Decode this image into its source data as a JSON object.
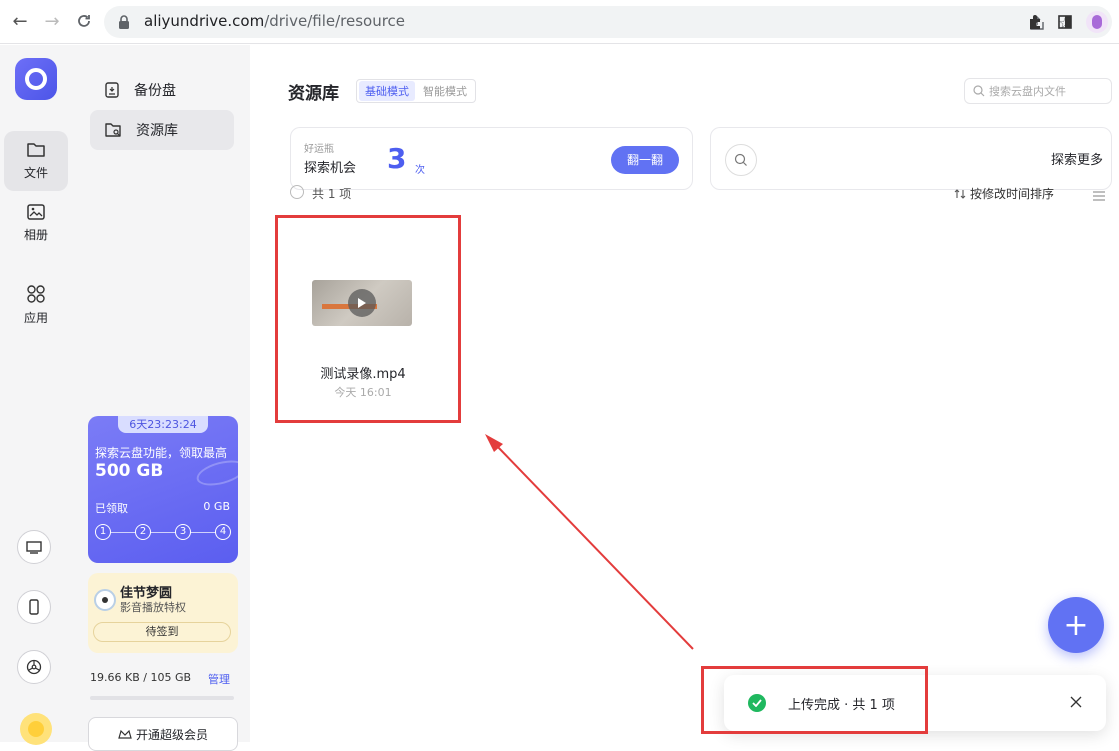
{
  "browser": {
    "url_domain": "aliyundrive.com",
    "url_path": "/drive/file/resource"
  },
  "rail": {
    "items": [
      {
        "label": "文件",
        "icon": "folder-icon"
      },
      {
        "label": "相册",
        "icon": "photo-icon"
      },
      {
        "label": "应用",
        "icon": "apps-icon"
      }
    ]
  },
  "side": {
    "items": [
      {
        "label": "备份盘",
        "icon": "backup-disk-icon"
      },
      {
        "label": "资源库",
        "icon": "resource-folder-icon"
      }
    ],
    "promo": {
      "timer": "6天23:23:24",
      "line1": "探索云盘功能，领取最高",
      "amount": "500 GB",
      "claimed_label": "已领取",
      "claimed_value": "0 GB",
      "steps": [
        "1",
        "2",
        "3",
        "4"
      ]
    },
    "festival": {
      "title": "佳节梦圆",
      "subtitle": "影音播放特权",
      "button": "待签到"
    },
    "storage": {
      "usage": "19.66 KB / 105 GB",
      "manage": "管理",
      "usage_fraction": 2e-07
    },
    "vip_button": "开通超级会员"
  },
  "main": {
    "title": "资源库",
    "mode_basic": "基础模式",
    "mode_smart": "智能模式",
    "search_placeholder": "搜索云盘内文件",
    "lucky": {
      "small_label": "好运瓶",
      "label": "探索机会",
      "count": "3",
      "unit": "次",
      "button": "翻一翻"
    },
    "explore": {
      "label": "探索更多"
    },
    "count_label": "共 1 项",
    "sort_label": "按修改时间排序",
    "files": [
      {
        "name": "测试录像.mp4",
        "time": "今天 16:01"
      }
    ],
    "toast": {
      "text": "上传完成 · 共 1 项"
    }
  },
  "colors": {
    "accent": "#6172f3",
    "highlight": "#e33c3c",
    "success": "#1fb85f"
  }
}
